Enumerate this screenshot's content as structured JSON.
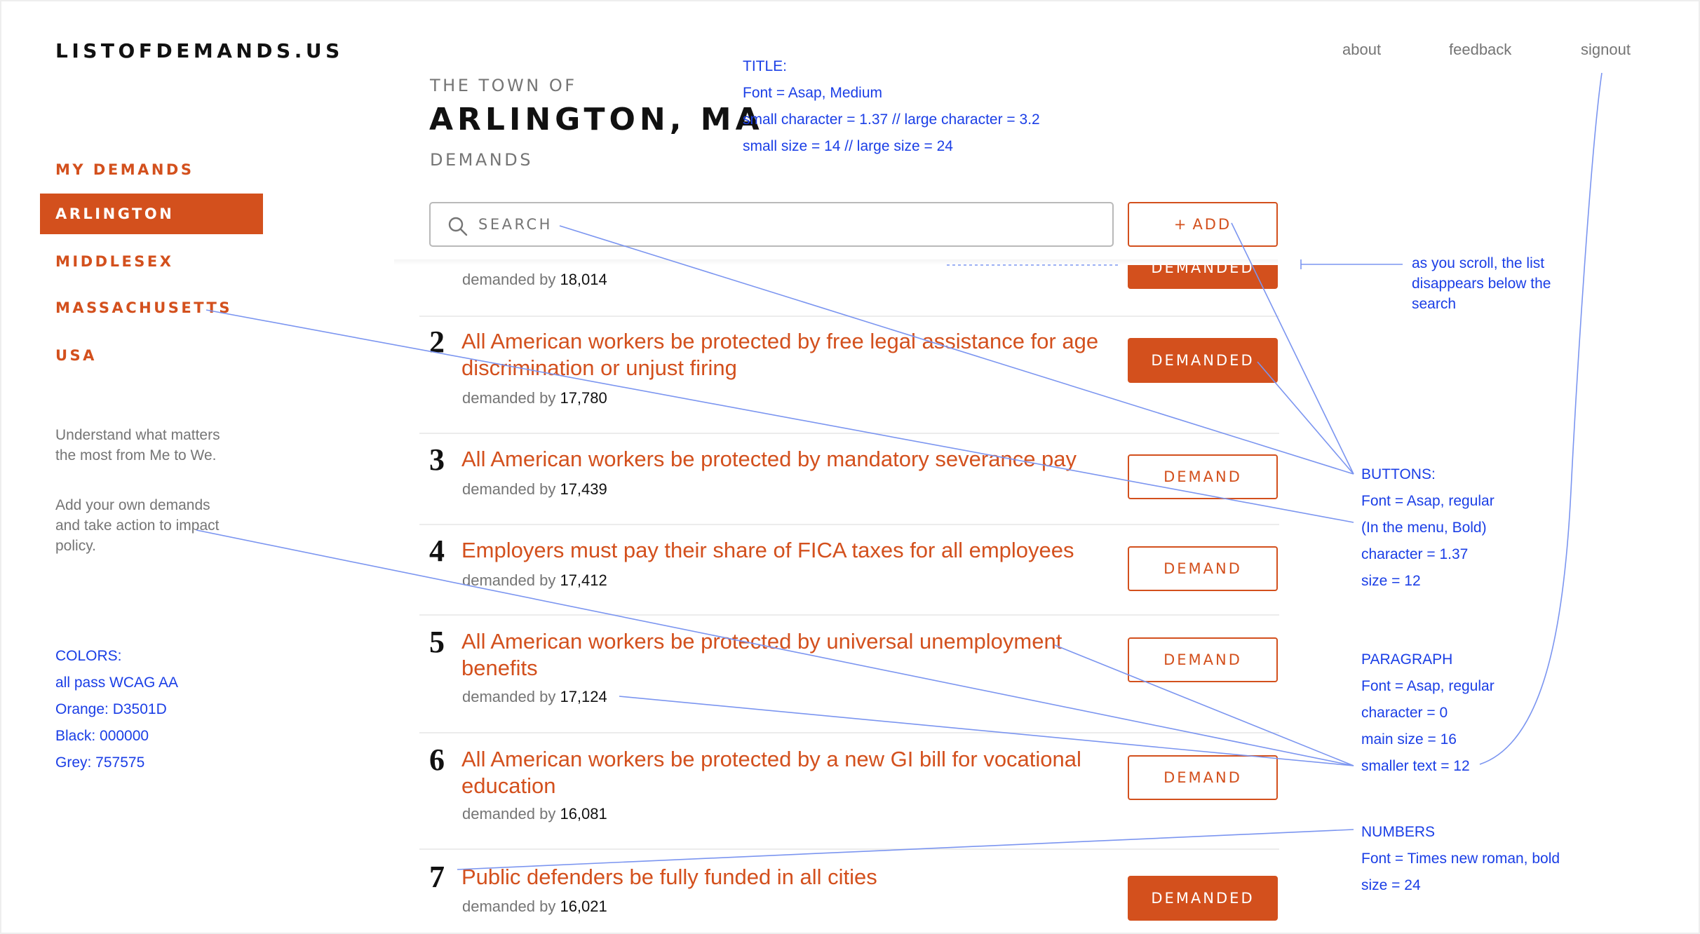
{
  "brand": "LISTOFDEMANDS.US",
  "top_nav": [
    "about",
    "feedback",
    "signout"
  ],
  "sidebar": {
    "items": [
      {
        "label": "MY DEMANDS",
        "active": false
      },
      {
        "label": "ARLINGTON",
        "active": true
      },
      {
        "label": "MIDDLESEX",
        "active": false
      },
      {
        "label": "MASSACHUSETTS",
        "active": false
      },
      {
        "label": "USA",
        "active": false
      }
    ],
    "paragraphs": [
      "Understand what matters the most from Me to We.",
      "Add your own demands and take action to impact policy."
    ]
  },
  "title": {
    "prefix": "THE TOWN OF",
    "name": "ARLINGTON, MA",
    "suffix": "DEMANDS"
  },
  "search": {
    "placeholder": "SEARCH",
    "icon": "search-icon"
  },
  "add_button": {
    "icon": "+",
    "label": "ADD"
  },
  "list": {
    "demanded_by_label": "demanded by",
    "partial_row": {
      "count": "18,014",
      "button": "DEMANDED"
    },
    "items": [
      {
        "number": "2",
        "title": "All American workers be protected by free legal assistance for age discrimination or unjust firing",
        "count": "17,780",
        "button": "DEMANDED",
        "demanded": true
      },
      {
        "number": "3",
        "title": "All American workers be protected by mandatory severance pay",
        "count": "17,439",
        "button": "DEMAND",
        "demanded": false
      },
      {
        "number": "4",
        "title": "Employers must pay their share of FICA taxes for all employees",
        "count": "17,412",
        "button": "DEMAND",
        "demanded": false
      },
      {
        "number": "5",
        "title": "All American workers be protected by universal unemployment benefits",
        "count": "17,124",
        "button": "DEMAND",
        "demanded": false
      },
      {
        "number": "6",
        "title": "All American workers be protected by a new GI bill for vocational education",
        "count": "16,081",
        "button": "DEMAND",
        "demanded": false
      },
      {
        "number": "7",
        "title": "Public defenders be fully funded in all cities",
        "count": "16,021",
        "button": "DEMANDED",
        "demanded": true
      }
    ]
  },
  "annotations": {
    "title_spec": [
      "TITLE:",
      "Font = Asap, Medium",
      "small character = 1.37  //  large character = 3.2",
      "small size = 14   //   large size = 24"
    ],
    "scroll_note": "as you scroll, the list disappears below the search",
    "buttons_spec": [
      "BUTTONS:",
      "Font = Asap, regular",
      "(In the menu, Bold)",
      "character = 1.37",
      "size = 12"
    ],
    "paragraph_spec": [
      "PARAGRAPH",
      "Font = Asap, regular",
      "character = 0",
      "main size = 16",
      "smaller text = 12"
    ],
    "numbers_spec": [
      "NUMBERS",
      "Font = Times new roman, bold",
      "size = 24"
    ],
    "colors_spec": [
      "COLORS:",
      "all pass WCAG AA",
      "Orange: D3501D",
      "Black: 000000",
      "Grey: 757575"
    ]
  },
  "colors": {
    "orange": "#D3501D",
    "black": "#000000",
    "grey": "#757575",
    "annotation_blue": "#1a3ee6"
  }
}
